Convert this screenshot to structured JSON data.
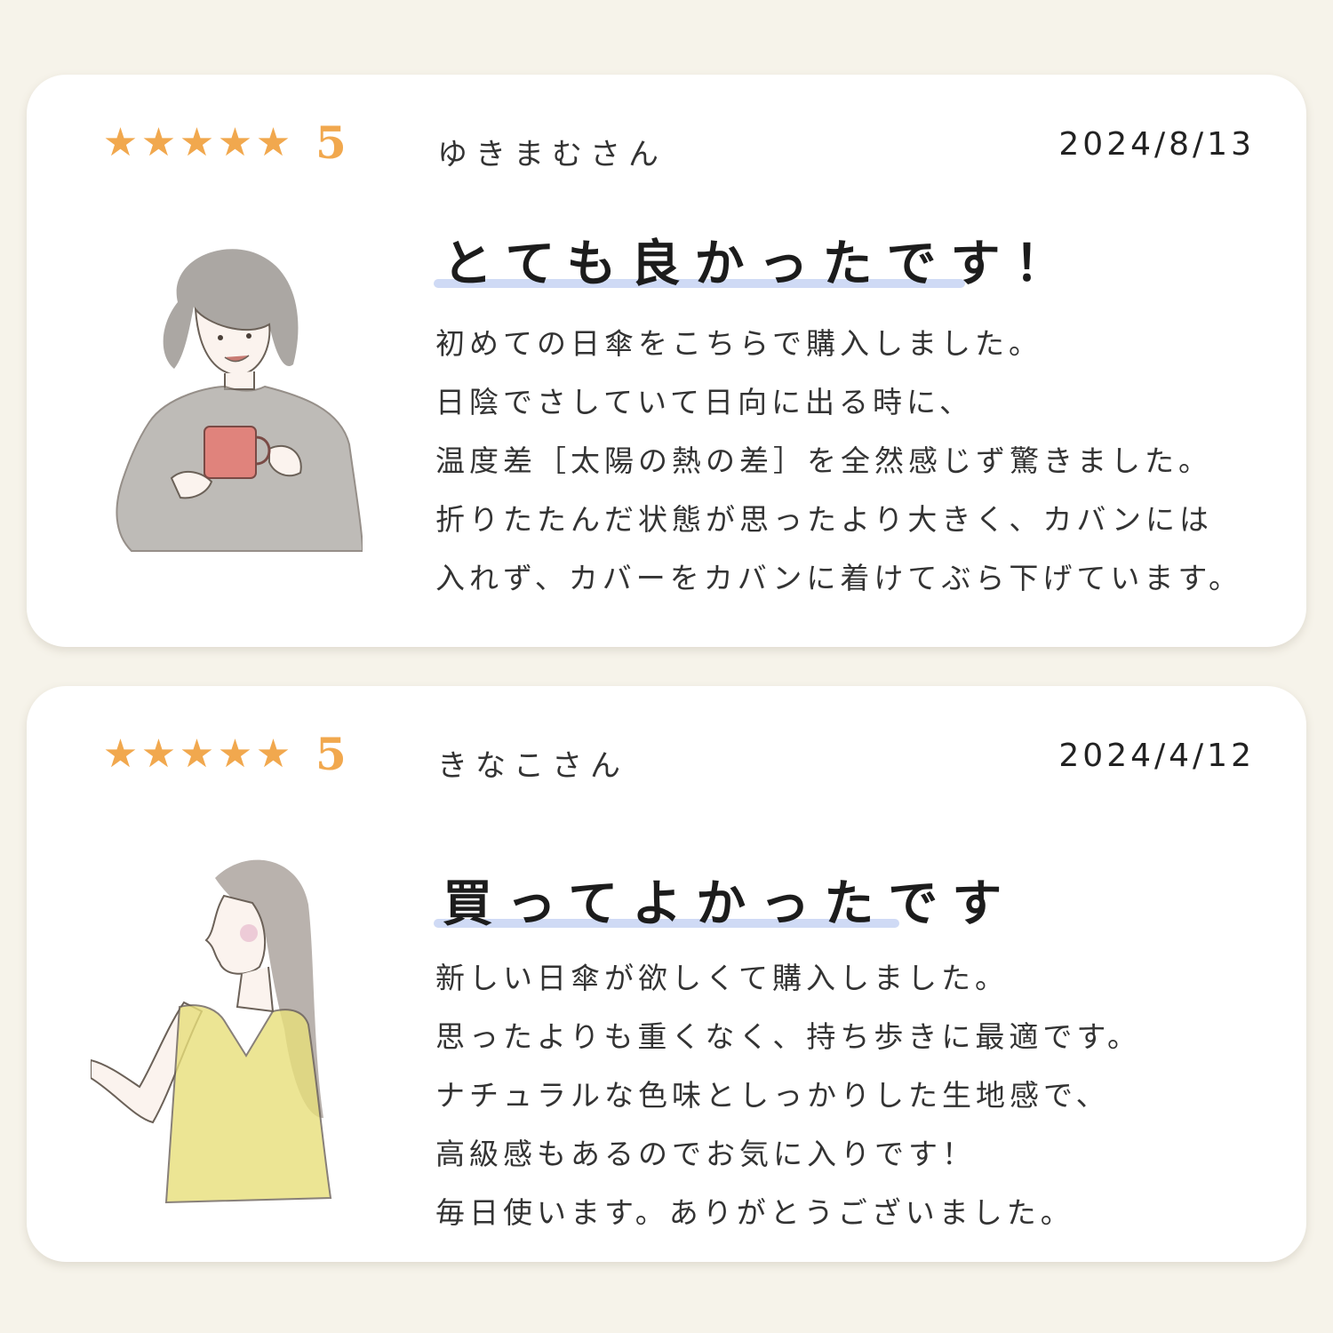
{
  "reviews": [
    {
      "stars_icon": "star-icon",
      "rating": "5",
      "reviewer": "ゆきまむさん",
      "date": "2024/8/13",
      "title": "とても良かったです！",
      "body": [
        "初めての日傘をこちらで購入しました。",
        "日陰でさしていて日向に出る時に、",
        "温度差［太陽の熱の差］を全然感じず驚きました。",
        "折りたたんだ状態が思ったより大きく、カバンには",
        "入れず、カバーをカバンに着けてぶら下げています。"
      ]
    },
    {
      "stars_icon": "star-icon",
      "rating": "5",
      "reviewer": "きなこさん",
      "date": "2024/4/12",
      "title": "買ってよかったです",
      "body": [
        "新しい日傘が欲しくて購入しました。",
        "思ったよりも重くなく、持ち歩きに最適です。",
        "ナチュラルな色味としっかりした生地感で、",
        "高級感もあるのでお気に入りです！",
        "毎日使います。ありがとうございました。"
      ]
    }
  ],
  "colors": {
    "star": "#f1a84e",
    "underline": "#cfdaf5",
    "background": "#f6f3ea"
  }
}
